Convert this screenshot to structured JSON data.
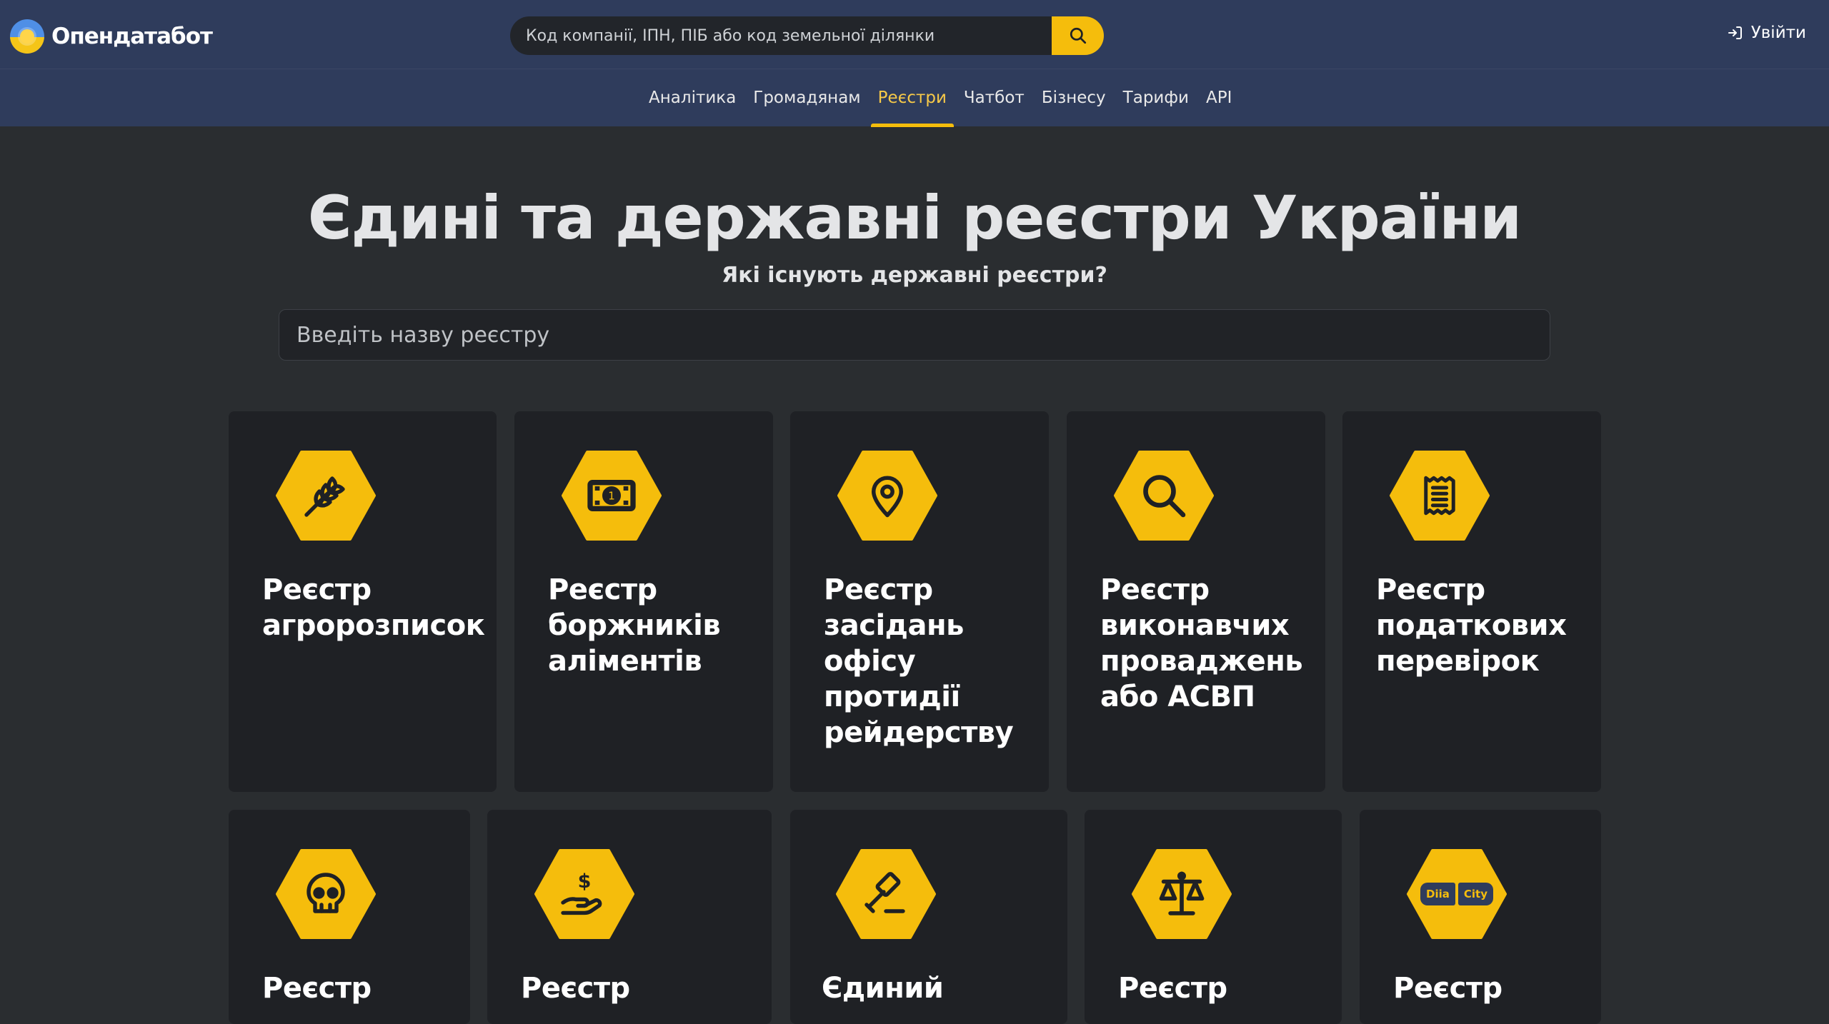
{
  "header": {
    "logo_text": "Опендатабот",
    "search_placeholder": "Код компанії, ІПН, ПІБ або код земельної ділянки",
    "login_label": "Увійти"
  },
  "nav": {
    "items": [
      "Аналітика",
      "Громадянам",
      "Реєстри",
      "Чатбот",
      "Бізнесу",
      "Тарифи",
      "API"
    ],
    "active": "Реєстри"
  },
  "hero": {
    "title": "Єдині та державні реєстри України",
    "subtitle": "Які існують державні реєстри?",
    "search_placeholder": "Введіть назву реєстру"
  },
  "cards": [
    {
      "title": "Реєстр агророзписок",
      "icon": "wheat-icon"
    },
    {
      "title": "Реєстр боржників аліментів",
      "icon": "banknote-icon"
    },
    {
      "title": "Реєстр засідань офісу протидії рейдерству",
      "icon": "map-pin-icon"
    },
    {
      "title": "Реєстр виконавчих проваджень або АСВП",
      "icon": "search-icon"
    },
    {
      "title": "Реєстр податкових перевірок",
      "icon": "receipt-icon"
    },
    {
      "title": "Реєстр",
      "icon": "skull-icon"
    },
    {
      "title": "Реєстр",
      "icon": "hand-dollar-icon"
    },
    {
      "title": "Єдиний",
      "icon": "gavel-icon"
    },
    {
      "title": "Реєстр",
      "icon": "scales-icon"
    },
    {
      "title": "Реєстр",
      "icon": "diia-city-icon"
    }
  ],
  "diia_city": {
    "left": "Diia",
    "right": "City"
  },
  "colors": {
    "header_bg": "#2f3c5c",
    "page_bg": "#2a2d30",
    "card_bg": "#1f2125",
    "accent": "#f5bd0c"
  }
}
